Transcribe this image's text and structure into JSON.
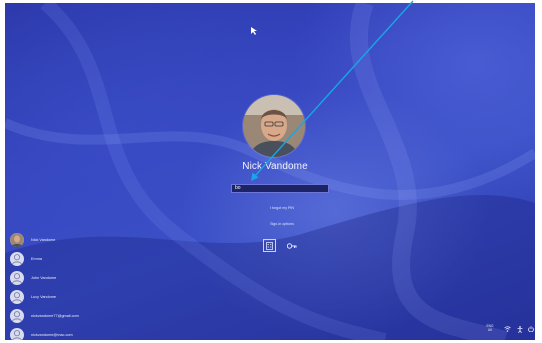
{
  "login": {
    "user_name": "Nick Vandome",
    "password_value": "bo",
    "forgot_pin": "I forgot my PIN",
    "sign_in_options": "Sign-in options"
  },
  "users": [
    {
      "name": "Nick Vandome",
      "has_photo": true
    },
    {
      "name": "Emma",
      "has_photo": false
    },
    {
      "name": "John Vandome",
      "has_photo": false
    },
    {
      "name": "Lucy Vandome",
      "has_photo": false
    },
    {
      "name": "nickvandome77@gmail.com",
      "has_photo": false
    },
    {
      "name": "nickvandome@mac.com",
      "has_photo": false
    }
  ],
  "tray": {
    "language": "ENG\nUK"
  },
  "icons": {
    "pin": "pin-keypad-icon",
    "key": "key-icon",
    "network": "network-icon",
    "accessibility": "ease-of-access-icon",
    "power": "power-icon"
  },
  "colors": {
    "background": "#3646c0",
    "arrow": "#16a7e6"
  }
}
